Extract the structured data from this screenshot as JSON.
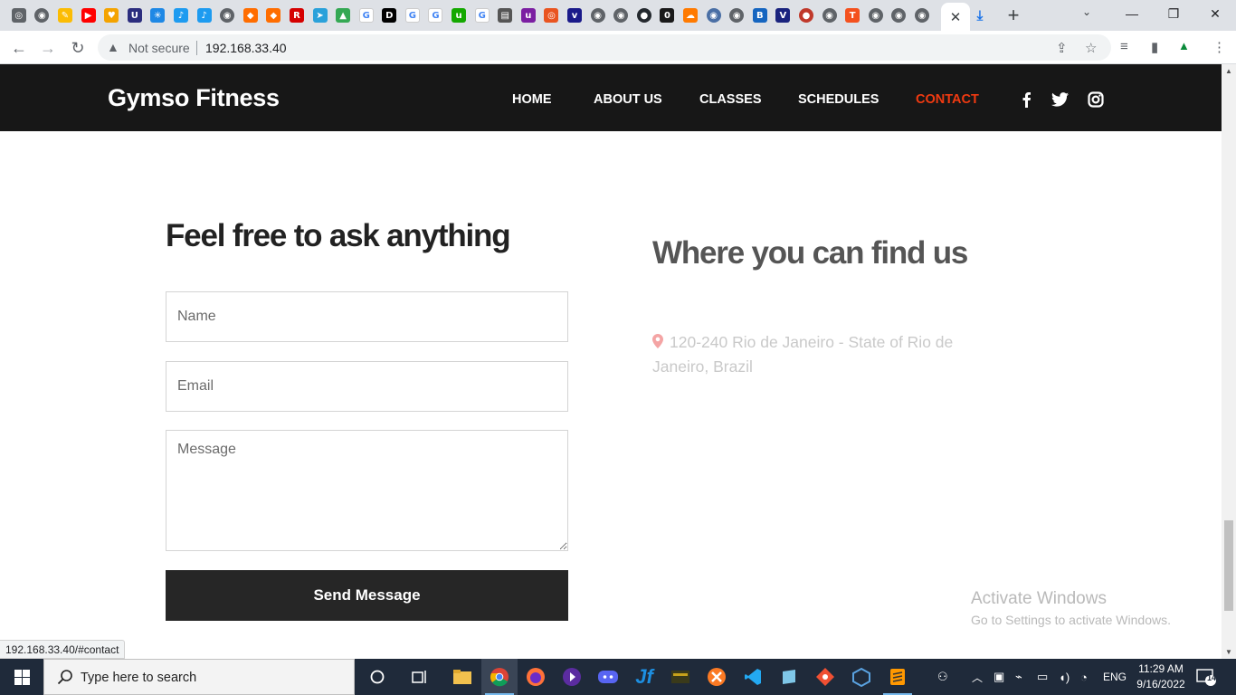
{
  "browser": {
    "active_tab_close": "✕",
    "new_tab": "+",
    "favicons": [
      {
        "name": "app-icon",
        "bg": "#5f6368",
        "glyph": "◎"
      },
      {
        "name": "chrome-gray-icon",
        "bg": "#5f6368",
        "glyph": "◉"
      },
      {
        "name": "drive-edit-icon",
        "bg": "#fbbc04",
        "glyph": "✎"
      },
      {
        "name": "youtube-icon",
        "bg": "#ff0000",
        "glyph": "▶"
      },
      {
        "name": "heart-icon",
        "bg": "#f4a300",
        "glyph": "♥"
      },
      {
        "name": "u-icon",
        "bg": "#2b2d7e",
        "glyph": "U"
      },
      {
        "name": "sparkle-icon",
        "bg": "#1e88e5",
        "glyph": "✳"
      },
      {
        "name": "bird-icon",
        "bg": "#1d9bf0",
        "glyph": "♪"
      },
      {
        "name": "bird2-icon",
        "bg": "#1d9bf0",
        "glyph": "♪"
      },
      {
        "name": "globe-icon",
        "bg": "#5f6368",
        "glyph": "◉"
      },
      {
        "name": "box-icon",
        "bg": "#ff6d00",
        "glyph": "◆"
      },
      {
        "name": "box2-icon",
        "bg": "#ff6d00",
        "glyph": "◆"
      },
      {
        "name": "r-icon",
        "bg": "#d50000",
        "glyph": "R"
      },
      {
        "name": "telegram-icon",
        "bg": "#2aa1da",
        "glyph": "➤"
      },
      {
        "name": "drive-icon",
        "bg": "#34a853",
        "glyph": "▲"
      },
      {
        "name": "google-icon",
        "bg": "#ffffff",
        "glyph": "G"
      },
      {
        "name": "dev-icon",
        "bg": "#000000",
        "glyph": "D"
      },
      {
        "name": "google2-icon",
        "bg": "#ffffff",
        "glyph": "G"
      },
      {
        "name": "google3-icon",
        "bg": "#ffffff",
        "glyph": "G"
      },
      {
        "name": "upwork-icon",
        "bg": "#14a800",
        "glyph": "u"
      },
      {
        "name": "google4-icon",
        "bg": "#ffffff",
        "glyph": "G"
      },
      {
        "name": "book-icon",
        "bg": "#555555",
        "glyph": "▤"
      },
      {
        "name": "purple-u-icon",
        "bg": "#7b1fa2",
        "glyph": "u"
      },
      {
        "name": "ubuntu-icon",
        "bg": "#e95420",
        "glyph": "◎"
      },
      {
        "name": "v-icon",
        "bg": "#1a1a8a",
        "glyph": "v"
      },
      {
        "name": "globe2-icon",
        "bg": "#5f6368",
        "glyph": "◉"
      },
      {
        "name": "globe3-icon",
        "bg": "#5f6368",
        "glyph": "◉"
      },
      {
        "name": "github-icon",
        "bg": "#24292e",
        "glyph": "●"
      },
      {
        "name": "zero-icon",
        "bg": "#1a1a1a",
        "glyph": "0"
      },
      {
        "name": "cloud-icon",
        "bg": "#ff7a00",
        "glyph": "☁"
      },
      {
        "name": "globe4-icon",
        "bg": "#4a6fa5",
        "glyph": "◉"
      },
      {
        "name": "globe5-icon",
        "bg": "#5f6368",
        "glyph": "◉"
      },
      {
        "name": "bootstrap-icon",
        "bg": "#1565c0",
        "glyph": "B"
      },
      {
        "name": "v2-icon",
        "bg": "#1a237e",
        "glyph": "V"
      },
      {
        "name": "avatar-icon",
        "bg": "#c0392b",
        "glyph": "●"
      },
      {
        "name": "globe6-icon",
        "bg": "#5f6368",
        "glyph": "◉"
      },
      {
        "name": "t-icon",
        "bg": "#f4511e",
        "glyph": "T"
      },
      {
        "name": "globe7-icon",
        "bg": "#5f6368",
        "glyph": "◉"
      },
      {
        "name": "globe8-icon",
        "bg": "#5f6368",
        "glyph": "◉"
      },
      {
        "name": "globe9-icon",
        "bg": "#5f6368",
        "glyph": "◉"
      }
    ]
  },
  "omnibox": {
    "security_label": "Not secure",
    "url": "192.168.33.40"
  },
  "site": {
    "brand": "Gymso Fitness",
    "nav": [
      {
        "label": "Home"
      },
      {
        "label": "About Us"
      },
      {
        "label": "Classes"
      },
      {
        "label": "Schedules"
      },
      {
        "label": "Contact"
      }
    ],
    "accent_color": "#f13a11"
  },
  "contact": {
    "title": "Feel free to ask anything",
    "name_placeholder": "Name",
    "email_placeholder": "Email",
    "message_placeholder": "Message",
    "send_label": "Send Message"
  },
  "location": {
    "title": "Where you can find us",
    "address": "120-240 Rio de Janeiro - State of Rio de Janeiro, Brazil"
  },
  "watermark": {
    "line1": "Activate Windows",
    "line2": "Go to Settings to activate Windows."
  },
  "status_url": "192.168.33.40/#contact",
  "taskbar": {
    "search_placeholder": "Type here to search",
    "language": "ENG",
    "time": "11:29 AM",
    "date": "9/16/2022",
    "notification_count": "14"
  }
}
